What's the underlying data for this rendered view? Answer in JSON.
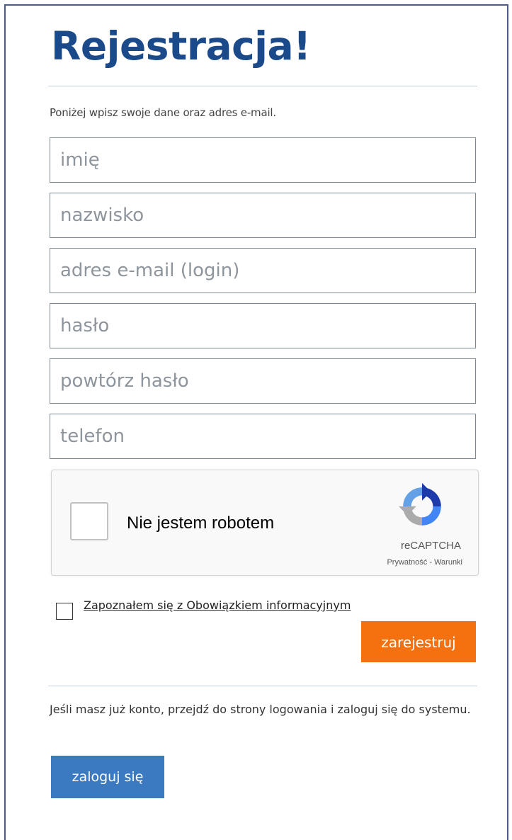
{
  "title": "Rejestracja!",
  "subtitle": "Poniżej wpisz swoje dane oraz adres e-mail.",
  "form": {
    "first_name": {
      "placeholder": "imię",
      "value": ""
    },
    "last_name": {
      "placeholder": "nazwisko",
      "value": ""
    },
    "email": {
      "placeholder": "adres e-mail (login)",
      "value": ""
    },
    "password": {
      "placeholder": "hasło",
      "value": ""
    },
    "password_repeat": {
      "placeholder": "powtórz hasło",
      "value": ""
    },
    "phone": {
      "placeholder": "telefon",
      "value": ""
    }
  },
  "captcha": {
    "label": "Nie jestem robotem",
    "brand": "reCAPTCHA",
    "terms": "Prywatność - Warunki",
    "checked": false
  },
  "info_obligation": {
    "label": "Zapoznałem się z Obowiązkiem informacyjnym",
    "checked": false
  },
  "register_button": "zarejestruj",
  "login_prompt": "Jeśli masz już konto, przejdź do strony logowania i zaloguj się do systemu.",
  "login_button": "zaloguj się",
  "colors": {
    "title": "#1a4a8a",
    "register_button": "#f5700f",
    "login_button": "#3b79c1",
    "field_border": "#7d8a96",
    "frame_border": "#4f5a8c"
  }
}
